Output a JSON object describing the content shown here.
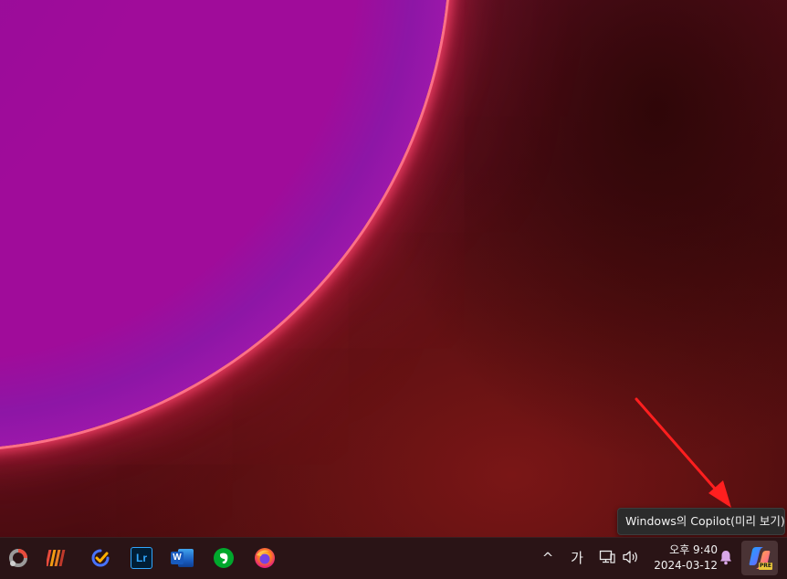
{
  "desktop": {
    "accent_colors": {
      "orb": "#a00c9a",
      "glow": "#ff3a6a",
      "background": "#4a0c10",
      "annotation_arrow": "#ff1f1f"
    }
  },
  "tooltip": {
    "text": "Windows의 Copilot(미리 보기)"
  },
  "taskbar": {
    "apps": [
      {
        "name": "ring-app-icon"
      },
      {
        "name": "stripes-app-icon"
      },
      {
        "name": "ticktick-icon"
      },
      {
        "name": "lightroom-icon",
        "label": "Lr"
      },
      {
        "name": "word-icon",
        "label": "W"
      },
      {
        "name": "evernote-icon"
      },
      {
        "name": "firefox-icon"
      }
    ],
    "tray": {
      "overflow_chevron": "^",
      "ime_indicator": "가",
      "network_icon": "network-icon",
      "volume_icon": "volume-icon"
    },
    "clock": {
      "time": "오후 9:40",
      "date": "2024-03-12"
    },
    "copilot": {
      "badge": "PRE"
    }
  }
}
